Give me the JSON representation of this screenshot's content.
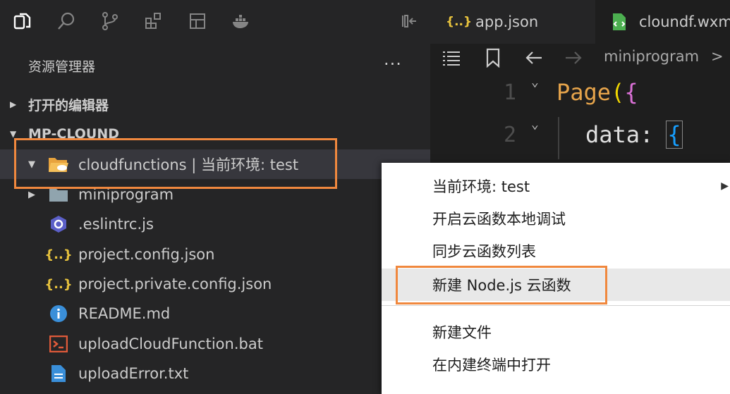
{
  "explorer": {
    "title": "资源管理器",
    "more": "...",
    "sections": [
      {
        "label": "打开的编辑器",
        "expanded": false
      },
      {
        "label": "MP-CLOUND",
        "expanded": true
      }
    ],
    "tree": [
      {
        "label": "cloudfunctions | 当前环境: test",
        "icon": "cloud-folder-open-icon",
        "expanded": true,
        "selected": true
      },
      {
        "label": "miniprogram",
        "icon": "folder-icon",
        "expanded": false
      },
      {
        "label": ".eslintrc.js",
        "icon": "eslint-icon"
      },
      {
        "label": "project.config.json",
        "icon": "json-braces-icon"
      },
      {
        "label": "project.private.config.json",
        "icon": "json-braces-icon"
      },
      {
        "label": "README.md",
        "icon": "info-icon"
      },
      {
        "label": "uploadCloudFunction.bat",
        "icon": "terminal-icon"
      },
      {
        "label": "uploadError.txt",
        "icon": "file-text-icon"
      }
    ]
  },
  "tabs": [
    {
      "label": "app.json",
      "icon": "json-braces-icon",
      "active": false
    },
    {
      "label": "cloundf.wxml",
      "icon": "wxml-file-icon",
      "active": true
    }
  ],
  "breadcrumb": {
    "segment": "miniprogram",
    "sep": ">"
  },
  "editor": {
    "lines": [
      {
        "num": "1",
        "text": "Page({"
      },
      {
        "num": "2",
        "text": "data: {"
      }
    ],
    "code": {
      "page": "Page",
      "paren": "(",
      "brace_open": "{",
      "data_key": "data",
      "colon": ":"
    }
  },
  "context_menu": {
    "items": [
      {
        "label": "当前环境: test",
        "has_submenu": true,
        "arrow": "▶"
      },
      {
        "label": "开启云函数本地调试"
      },
      {
        "label": "同步云函数列表"
      },
      {
        "label": "新建 Node.js 云函数",
        "hovered": true
      },
      {
        "label": "新建文件"
      },
      {
        "label": "在内建终端中打开"
      }
    ]
  },
  "colors": {
    "accent_highlight": "#f0883e",
    "sidebar_bg": "#252526",
    "editor_bg": "#1e1e1e",
    "selected_row": "#37373d"
  }
}
